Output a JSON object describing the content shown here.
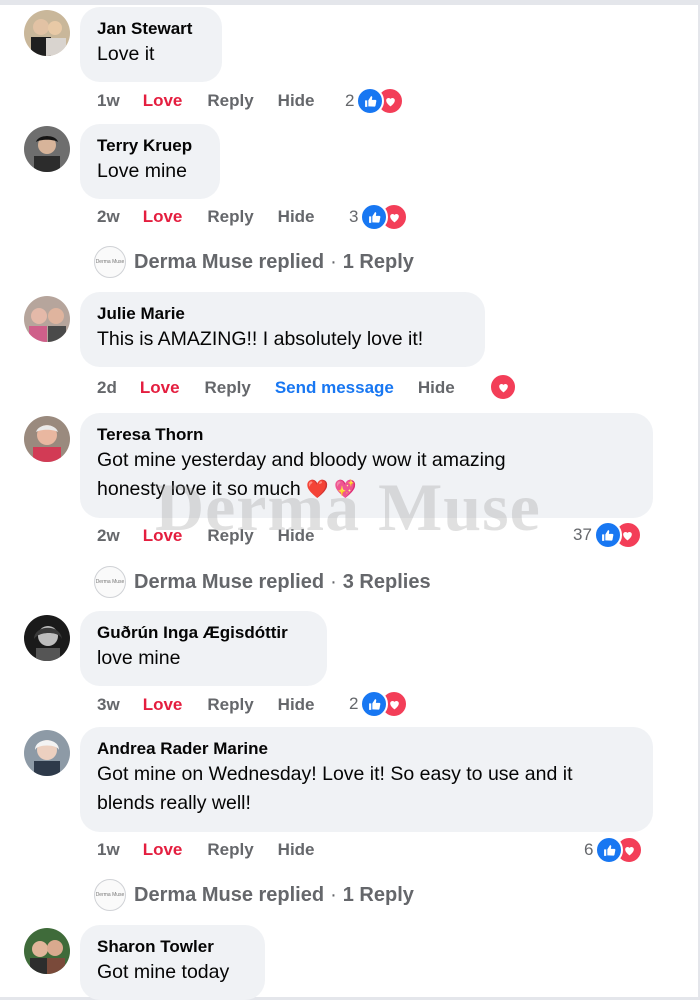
{
  "comments": [
    {
      "name": "Jan Stewart",
      "text": "Love it",
      "time": "1w",
      "love": "Love",
      "reply": "Reply",
      "hide": "Hide",
      "count": "2"
    },
    {
      "name": "Terry Kruep",
      "text": "Love mine",
      "time": "2w",
      "love": "Love",
      "reply": "Reply",
      "hide": "Hide",
      "count": "3"
    },
    {
      "name": "Julie Marie",
      "text": "This is AMAZING!! I absolutely love it!",
      "time": "2d",
      "love": "Love",
      "reply": "Reply",
      "send_message": "Send message",
      "hide": "Hide"
    },
    {
      "name": "Teresa Thorn",
      "text_line1": "Got mine yesterday and bloody wow it amazing",
      "text_line2": "honesty love it so much",
      "emoji1": "❤️",
      "emoji2": "💖",
      "time": "2w",
      "love": "Love",
      "reply": "Reply",
      "hide": "Hide",
      "count": "37"
    },
    {
      "name": "Guðrún Inga Ægisdóttir",
      "text": "love mine",
      "time": "3w",
      "love": "Love",
      "reply": "Reply",
      "hide": "Hide",
      "count": "2"
    },
    {
      "name": "Andrea Rader Marine",
      "text_line1": "Got mine on Wednesday! Love it! So easy to use and it",
      "text_line2": "blends really well!",
      "time": "1w",
      "love": "Love",
      "reply": "Reply",
      "hide": "Hide",
      "count": "6"
    },
    {
      "name": "Sharon Towler",
      "text": "Got mine today"
    }
  ],
  "replies": [
    {
      "page": "Derma Muse",
      "label": "Derma Muse replied",
      "sep": "·",
      "count": "1 Reply"
    },
    {
      "page": "Derma Muse",
      "label": "Derma Muse replied",
      "sep": "·",
      "count": "3 Replies"
    },
    {
      "page": "Derma Muse",
      "label": "Derma Muse replied",
      "sep": "·",
      "count": "1 Reply"
    }
  ],
  "watermark": "Derma Muse",
  "colors": {
    "like": "#1877f2",
    "love": "#f33e58",
    "love_text": "#e41e3f",
    "bubble": "#f0f2f5",
    "meta": "#65676b"
  },
  "icons": [
    "like-icon",
    "heart-icon"
  ]
}
